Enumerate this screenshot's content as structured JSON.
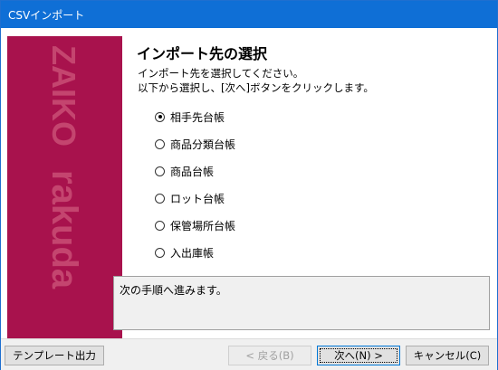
{
  "window": {
    "title": "CSVインポート"
  },
  "banner": {
    "logo_line1": "ZAIKO",
    "logo_line2": "rakuda",
    "color": "#a8124d"
  },
  "panel": {
    "title": "インポート先の選択",
    "desc1": "インポート先を選択してください。",
    "desc2": "以下から選択し、[次へ]ボタンをクリックします。"
  },
  "options": [
    {
      "label": "相手先台帳",
      "checked": true
    },
    {
      "label": "商品分類台帳",
      "checked": false
    },
    {
      "label": "商品台帳",
      "checked": false
    },
    {
      "label": "ロット台帳",
      "checked": false
    },
    {
      "label": "保管場所台帳",
      "checked": false
    },
    {
      "label": "入出庫帳",
      "checked": false
    }
  ],
  "message": "次の手順へ進みます。",
  "buttons": {
    "template": "テンプレート出力",
    "back": "< 戻る(B)",
    "next": "次へ(N) >",
    "cancel": "キャンセル(C)"
  }
}
